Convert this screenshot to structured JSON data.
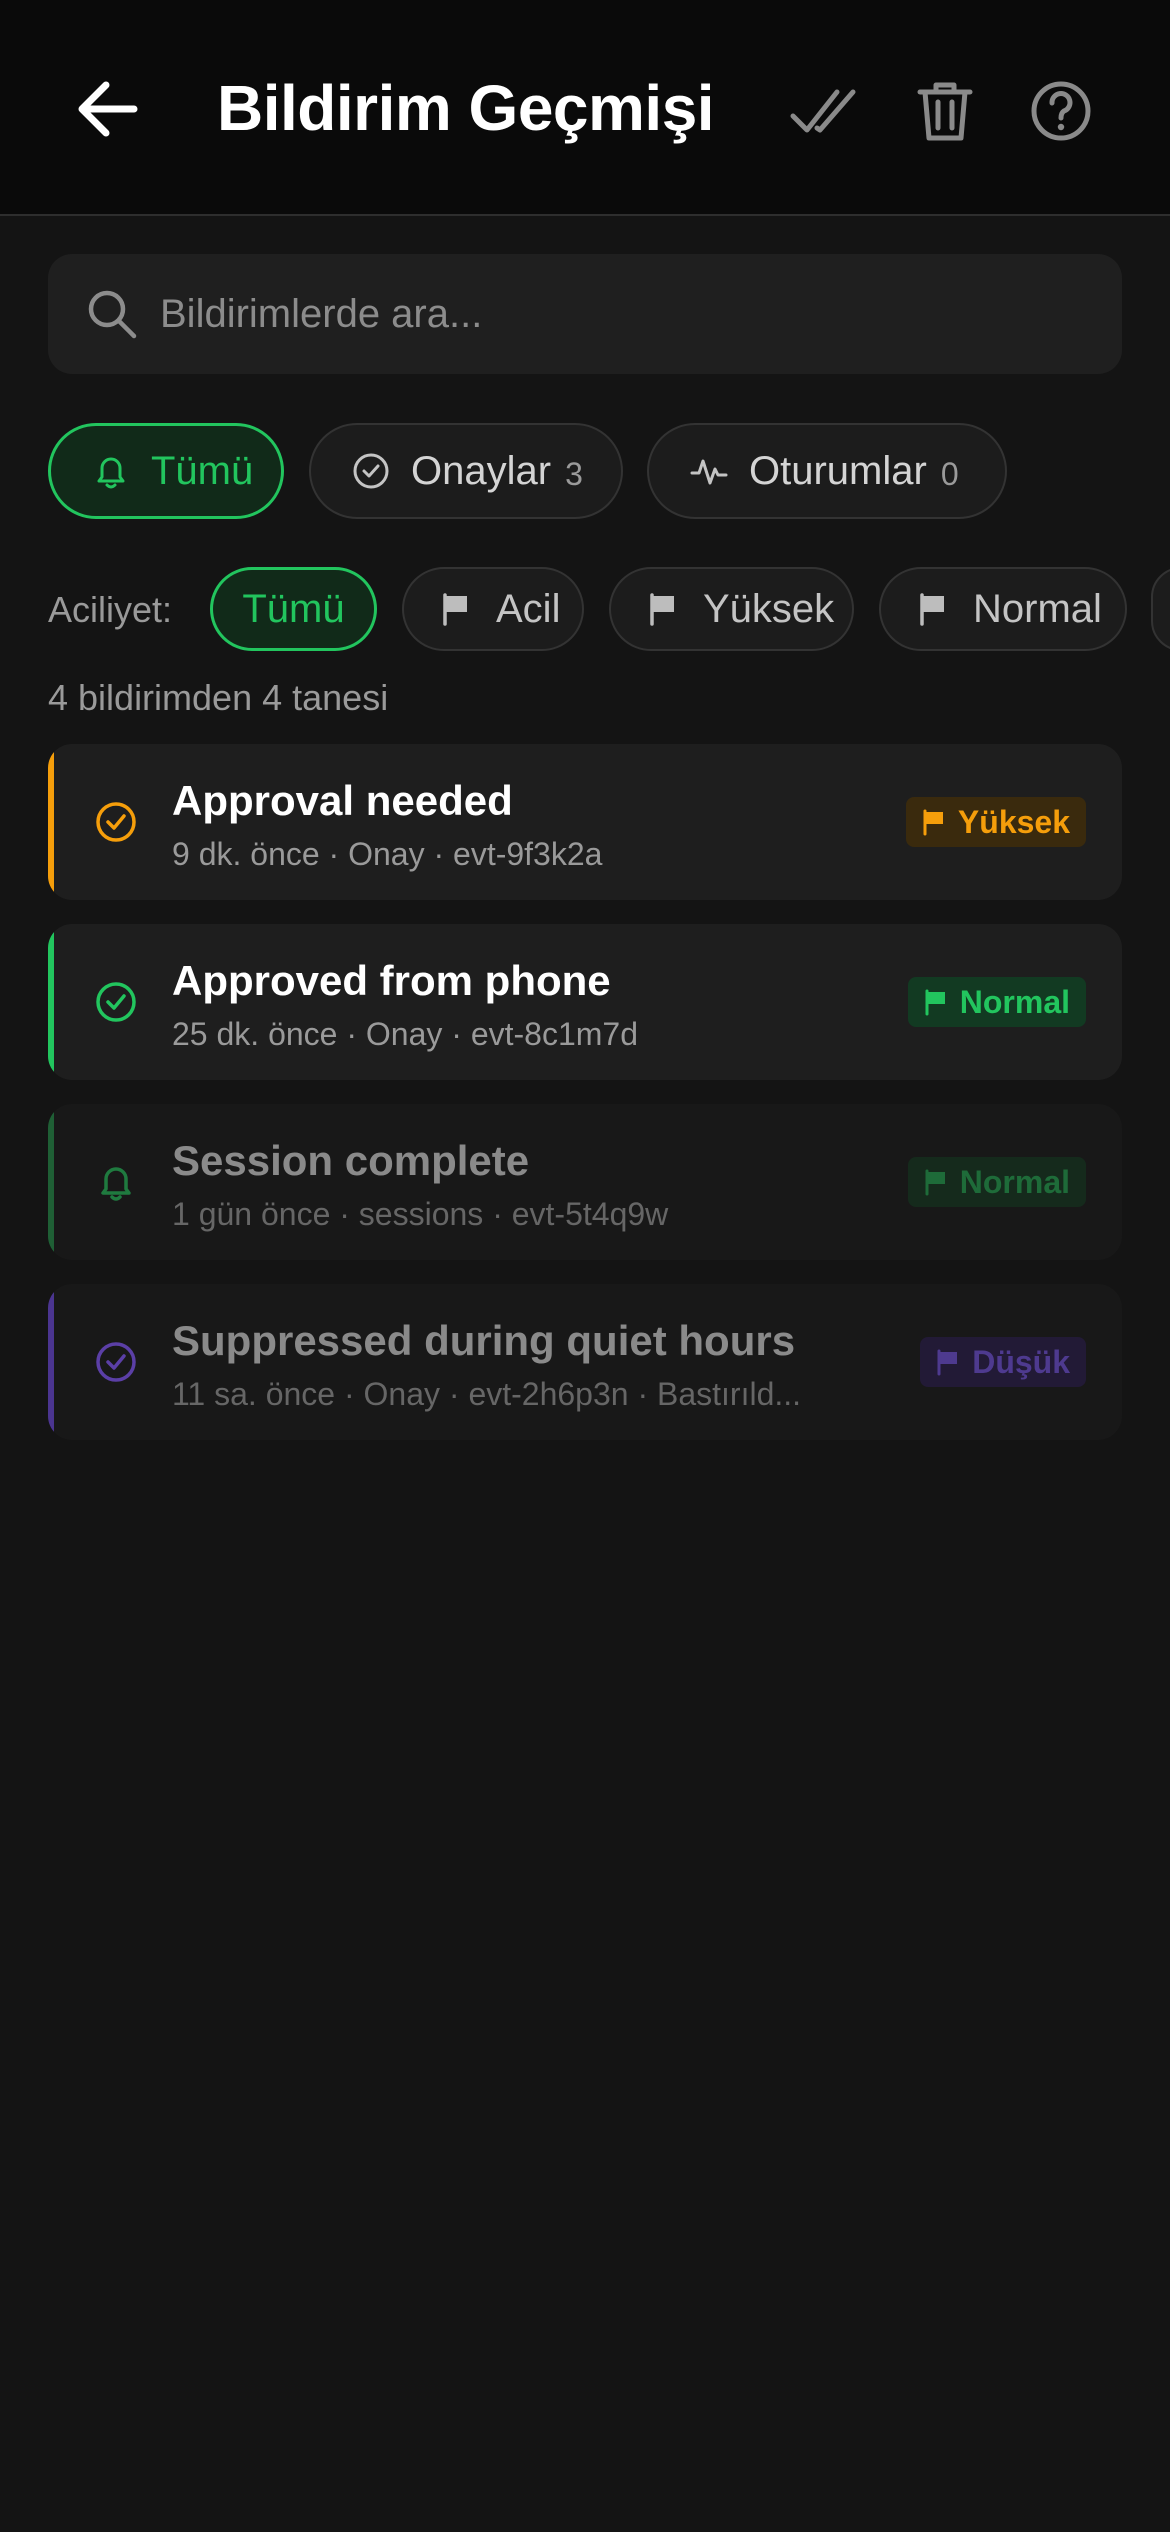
{
  "header": {
    "title": "Bildirim Geçmişi",
    "back_icon": "arrow-left-icon",
    "actions": [
      "double-check-icon",
      "trash-icon",
      "help-circle-icon"
    ]
  },
  "search": {
    "placeholder": "Bildirimlerde ara...",
    "value": ""
  },
  "tabs": [
    {
      "label": "Tümü",
      "count": "",
      "icon": "bell-icon",
      "active": true
    },
    {
      "label": "Onaylar",
      "count": "3",
      "icon": "check-circle-icon",
      "active": false
    },
    {
      "label": "Oturumlar",
      "count": "0",
      "icon": "activity-icon",
      "active": false
    }
  ],
  "urgency": {
    "label": "Aciliyet:",
    "chips": [
      {
        "label": "Tümü",
        "active": true
      },
      {
        "label": "Acil",
        "icon": "flag-icon"
      },
      {
        "label": "Yüksek",
        "icon": "flag-icon"
      },
      {
        "label": "Normal",
        "icon": "flag-icon"
      }
    ]
  },
  "count_text": "4 bildirimden 4 tanesi",
  "notifications": [
    {
      "title": "Approval needed",
      "meta": "9 dk. önce · Onay · evt-9f3k2a",
      "badge": "Yüksek",
      "icon": "check-circle-icon",
      "color": "#f59e0b",
      "dim": false
    },
    {
      "title": "Approved from phone",
      "meta": "25 dk. önce · Onay · evt-8c1m7d",
      "badge": "Normal",
      "icon": "check-circle-icon",
      "color": "#22c55e",
      "dim": false
    },
    {
      "title": "Session complete",
      "meta": "1 gün önce · sessions · evt-5t4q9w",
      "badge": "Normal",
      "icon": "bell-icon",
      "color": "#1f7a3f",
      "dim": true
    },
    {
      "title": "Suppressed during quiet hours",
      "meta": "11 sa. önce · Onay · evt-2h6p3n · Bastırıld...",
      "badge": "Düşük",
      "icon": "check-circle-icon",
      "color": "#5b3fa6",
      "dim": true
    }
  ],
  "colors": {
    "accent": "#22c55e",
    "high": "#f59e0b",
    "low": "#7c5cd6",
    "background": "#141414"
  }
}
